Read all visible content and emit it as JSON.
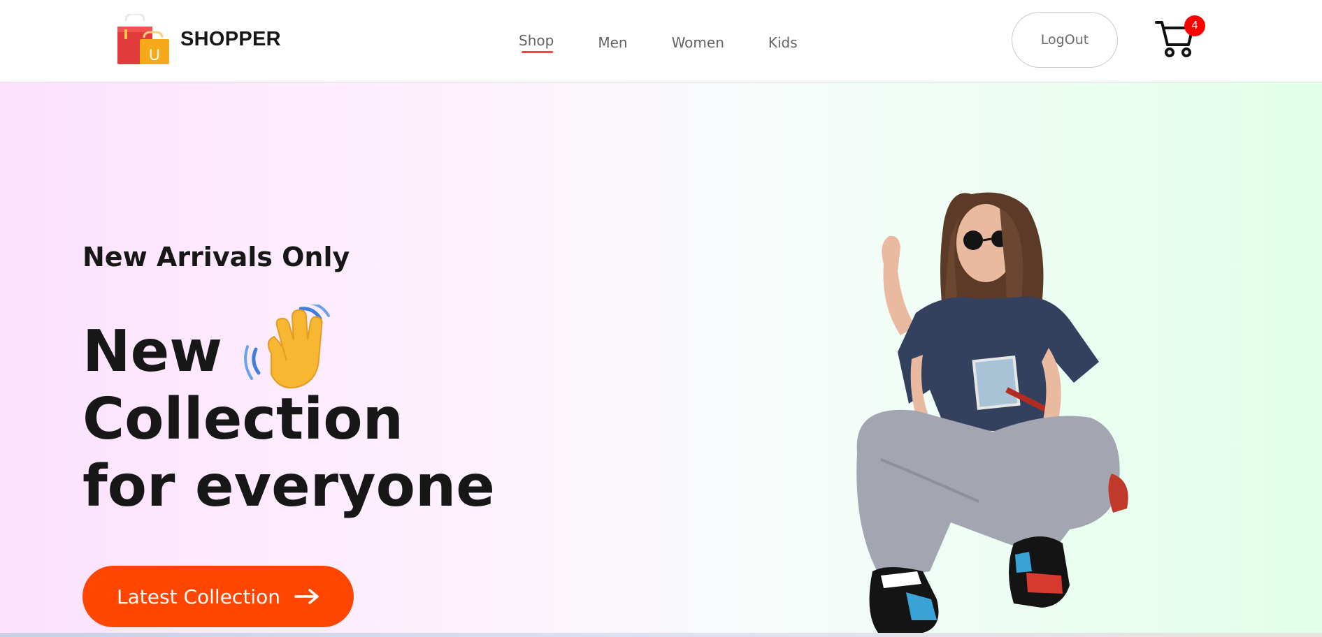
{
  "brand": {
    "name": "SHOPPER",
    "logo_badge_letter": "U",
    "logo_icon": "shopping-bags-icon"
  },
  "nav": {
    "items": [
      {
        "label": "Shop",
        "active": true
      },
      {
        "label": "Men",
        "active": false
      },
      {
        "label": "Women",
        "active": false
      },
      {
        "label": "Kids",
        "active": false
      }
    ],
    "logout_label": "LogOut",
    "cart_icon": "shopping-cart-icon",
    "cart_count": "4"
  },
  "hero": {
    "subtitle": "New Arrivals Only",
    "headline_line1": "New",
    "headline_line2": "Collection",
    "headline_line3": "for everyone",
    "wave_icon": "waving-hand-icon",
    "cta_label": "Latest Collection",
    "cta_icon": "arrow-right-icon",
    "image": "hero-model-image"
  },
  "colors": {
    "accent": "#ff4500",
    "nav_underline": "#ff4141",
    "cart_badge": "#ff0000",
    "text_dark": "#171717",
    "text_nav": "#626262",
    "hero_gradient_start": "#fde1ff",
    "hero_gradient_end": "#e1ffea"
  }
}
